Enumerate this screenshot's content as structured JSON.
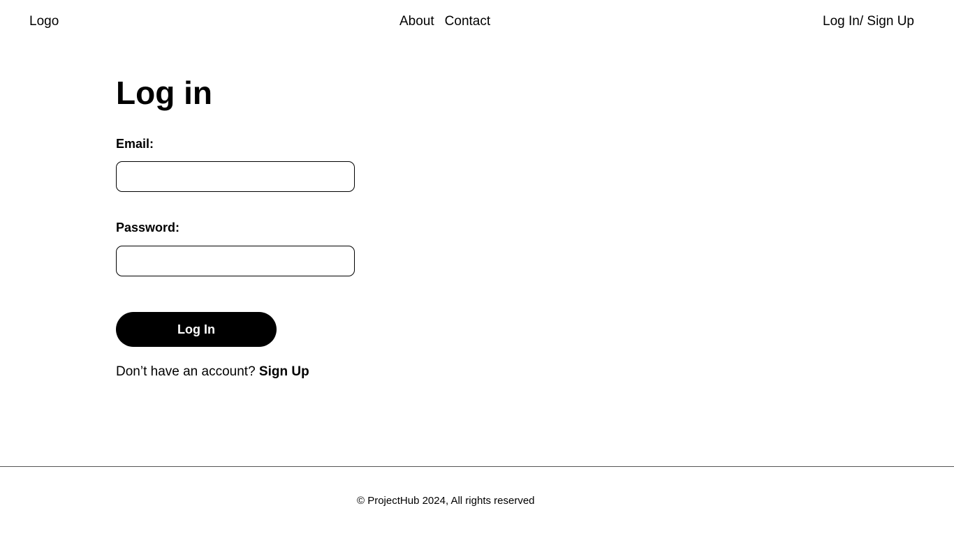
{
  "header": {
    "logo": "Logo",
    "nav": [
      {
        "label": "About"
      },
      {
        "label": "Contact"
      }
    ],
    "auth_link": "Log In/ Sign Up"
  },
  "login": {
    "title": "Log in",
    "email_label": "Email:",
    "email_value": "",
    "password_label": "Password:",
    "password_value": "",
    "submit_label": "Log In",
    "signup_prompt": "Don’t have an account?",
    "signup_link": "Sign Up"
  },
  "footer": {
    "copyright": "© ProjectHub 2024, All rights reserved"
  }
}
